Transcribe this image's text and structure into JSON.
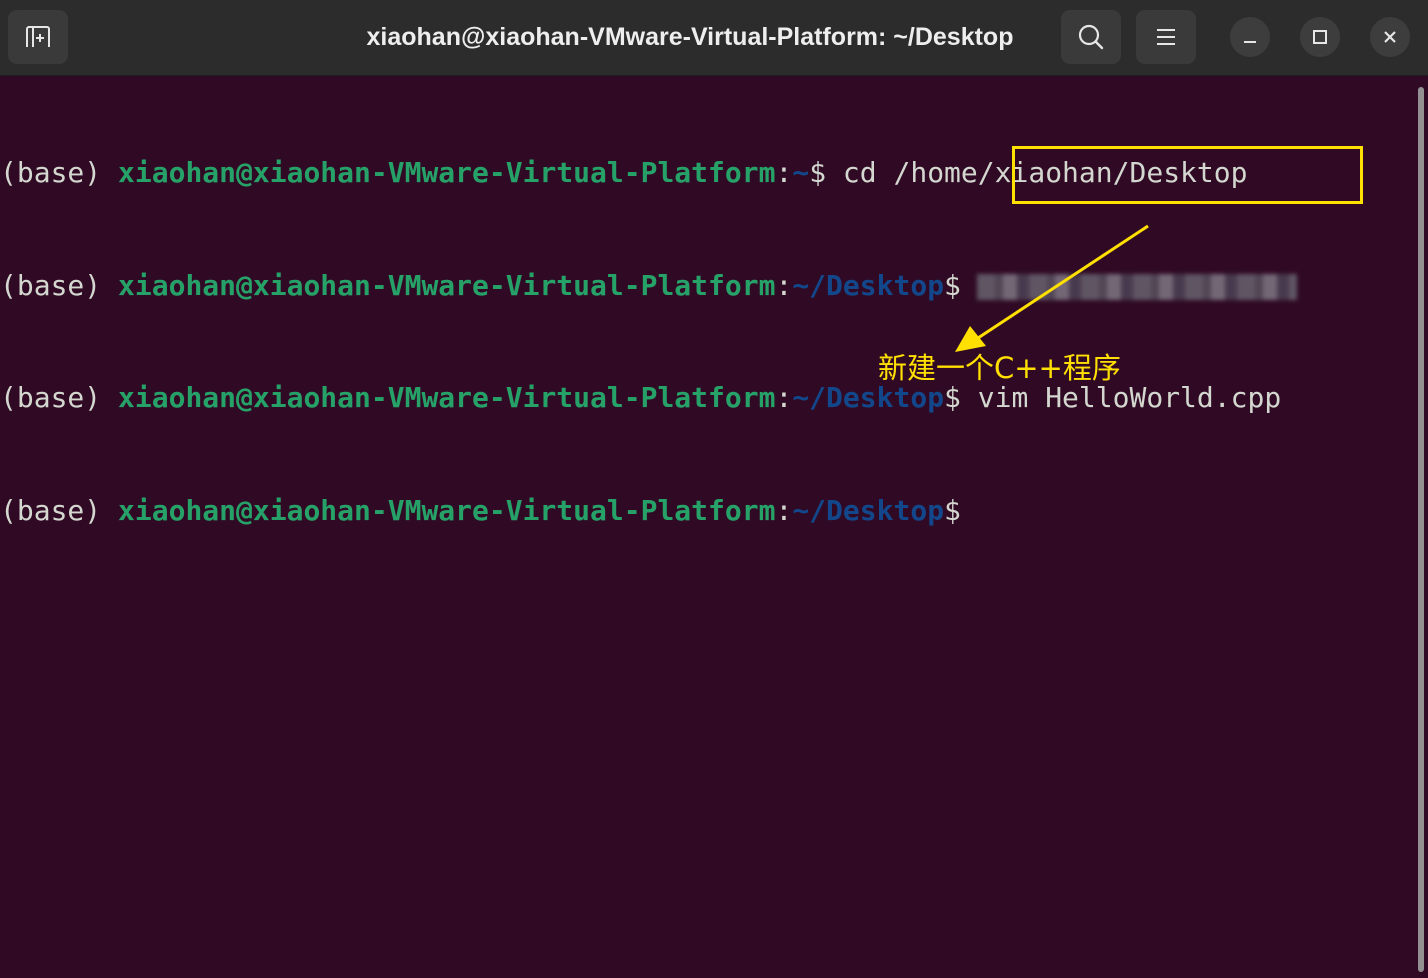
{
  "window": {
    "title": "xiaohan@xiaohan-VMware-Virtual-Platform: ~/Desktop"
  },
  "titlebar": {
    "new_tab_icon": "new-tab-icon",
    "search_icon": "search-icon",
    "menu_icon": "hamburger-menu-icon",
    "minimize_icon": "minimize-icon",
    "maximize_icon": "maximize-icon",
    "close_icon": "close-icon"
  },
  "terminal": {
    "lines": [
      {
        "env": "(base) ",
        "user": "xiaohan@xiaohan-VMware-Virtual-Platform",
        "sep": ":",
        "path": "~",
        "prompt": "$ ",
        "command": "cd /home/xiaohan/Desktop"
      },
      {
        "env": "(base) ",
        "user": "xiaohan@xiaohan-VMware-Virtual-Platform",
        "sep": ":",
        "path": "~/Desktop",
        "prompt": "$",
        "command": ""
      },
      {
        "env": "(base) ",
        "user": "xiaohan@xiaohan-VMware-Virtual-Platform",
        "sep": ":",
        "path": "~/Desktop",
        "prompt": "$ ",
        "command": "vim HelloWorld.cpp"
      },
      {
        "env": "(base) ",
        "user": "xiaohan@xiaohan-VMware-Virtual-Platform",
        "sep": ":",
        "path": "~/Desktop",
        "prompt": "$",
        "command": ""
      }
    ]
  },
  "annotation": {
    "text": "新建一个C++程序",
    "color": "#ffe000"
  },
  "colors": {
    "background": "#300a24",
    "user": "#26a269",
    "path": "#12488b",
    "text": "#d3d7cf"
  }
}
